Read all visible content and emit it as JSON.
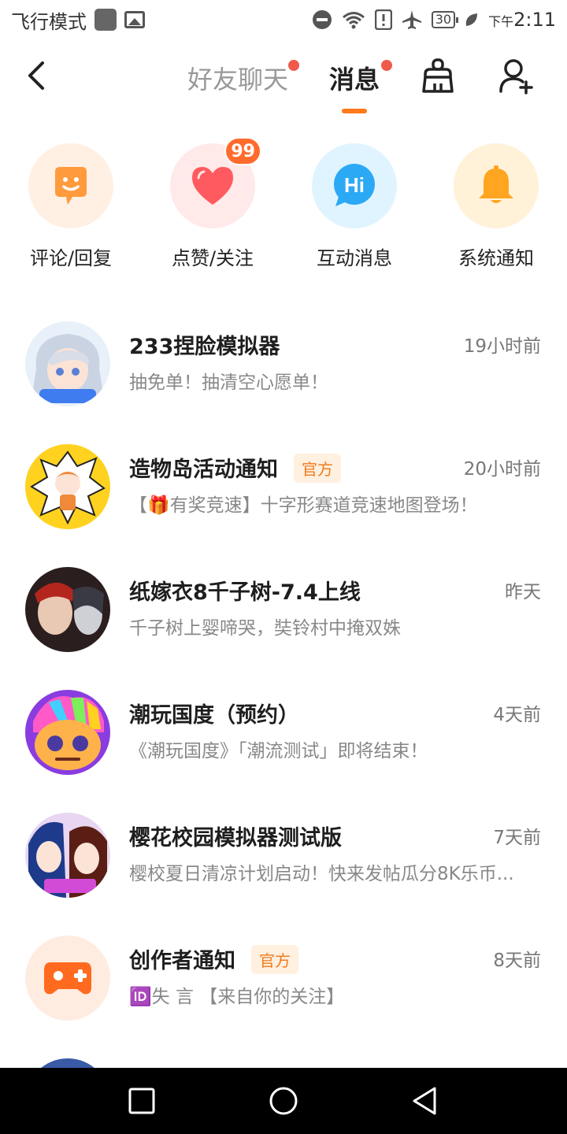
{
  "status_bar": {
    "left_text": "飞行模式",
    "time_prefix": "下午",
    "time": "2:11",
    "battery": "30",
    "icons": [
      "do-not-disturb-icon",
      "wifi-icon",
      "alert-icon",
      "airplane-icon",
      "battery-icon",
      "leaf-icon"
    ]
  },
  "header": {
    "tabs": [
      {
        "label": "好友聊天",
        "has_dot": true,
        "active": false
      },
      {
        "label": "消息",
        "has_dot": true,
        "active": true
      }
    ],
    "accent_color": "#ff7a1a"
  },
  "shortcuts": [
    {
      "label": "评论/回复",
      "icon": "comment-icon",
      "bg": "#fff0e3",
      "color": "#ff9a3d"
    },
    {
      "label": "点赞/关注",
      "icon": "heart-icon",
      "bg": "#ffe9e9",
      "color": "#ff5a5f",
      "badge": "99"
    },
    {
      "label": "互动消息",
      "icon": "hi-bubble-icon",
      "bg": "#e0f4ff",
      "color": "#2ba9f5",
      "badge_text": "Hi"
    },
    {
      "label": "系统通知",
      "icon": "bell-icon",
      "bg": "#fff2d9",
      "color": "#ffa51f"
    }
  ],
  "messages": [
    {
      "title": "233捏脸模拟器",
      "subtitle": "抽免单！抽清空心愿单！",
      "time": "19小时前",
      "official": ""
    },
    {
      "title": "造物岛活动通知",
      "subtitle": "【🎁有奖竞速】十字形赛道竞速地图登场！",
      "time": "20小时前",
      "official": "官方"
    },
    {
      "title": "纸嫁衣8千子树-7.4上线",
      "subtitle": "千子树上婴啼哭，奘铃村中掩双姝",
      "time": "昨天",
      "official": ""
    },
    {
      "title": "潮玩国度（预约）",
      "subtitle": "《潮玩国度》「潮流测试」即将结束！",
      "time": "4天前",
      "official": ""
    },
    {
      "title": "樱花校园模拟器测试版",
      "subtitle": "樱校夏日清凉计划启动！快来发帖瓜分8K乐币...",
      "time": "7天前",
      "official": ""
    },
    {
      "title": "创作者通知",
      "subtitle_prefix": "🆔",
      "subtitle": "失 言 【来自你的关注】",
      "time": "8天前",
      "official": "官方"
    }
  ]
}
